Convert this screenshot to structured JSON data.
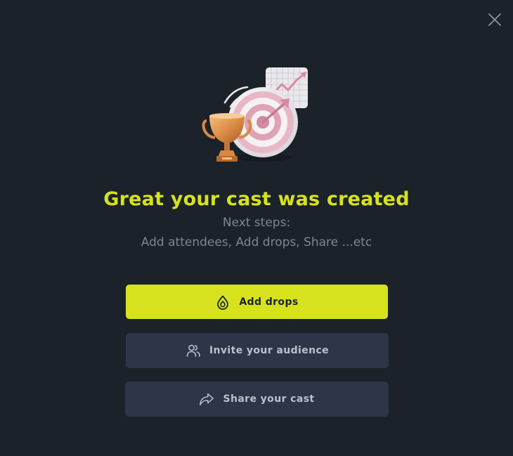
{
  "dialog": {
    "title": "Great your cast was created",
    "subtitle": "Next steps:",
    "steps_text": "Add attendees, Add drops, Share ...etc"
  },
  "actions": [
    {
      "label": "Add drops",
      "icon": "drop-icon",
      "style": "primary"
    },
    {
      "label": "Invite your audience",
      "icon": "users-icon",
      "style": "secondary"
    },
    {
      "label": "Share your cast",
      "icon": "share-arrow-icon",
      "style": "secondary"
    }
  ],
  "colors": {
    "background": "#1b222a",
    "accent": "#d6e21e",
    "secondary_button": "#2d3549",
    "muted_text": "#7c8592"
  }
}
